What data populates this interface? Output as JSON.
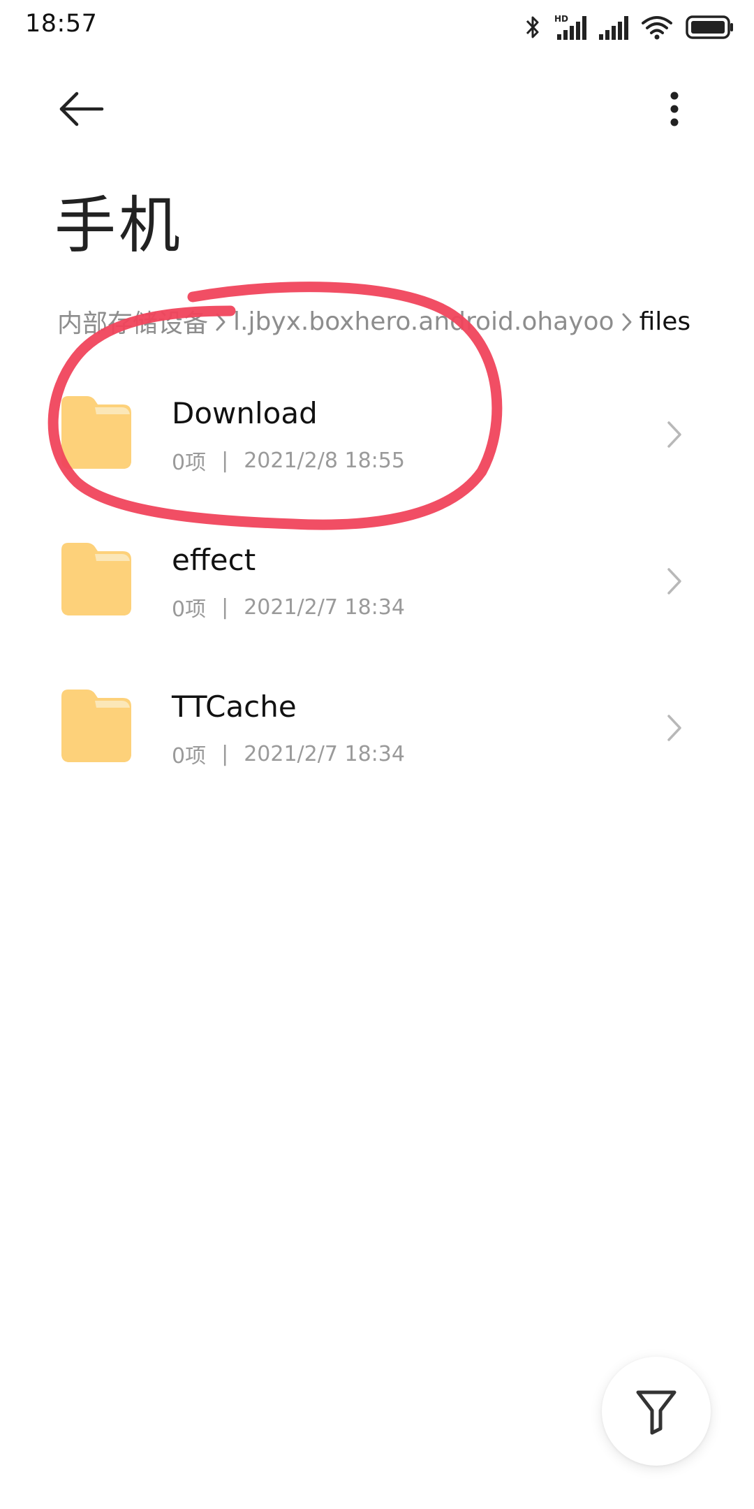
{
  "status_bar": {
    "time": "18:57",
    "icons": [
      "bluetooth-icon",
      "hd-signal-icon",
      "signal-icon",
      "wifi-icon",
      "battery-icon"
    ],
    "hd_label": "HD"
  },
  "toolbar": {
    "back_icon": "arrow-left-icon",
    "more_icon": "more-vertical-icon"
  },
  "page": {
    "title": "手机"
  },
  "breadcrumb": {
    "items": [
      {
        "label": "内部存储设备"
      },
      {
        "label": "l.jbyx.boxhero.android.ohayoo"
      },
      {
        "label": "files"
      }
    ]
  },
  "files": [
    {
      "name": "Download",
      "count": "0项",
      "date": "2021/2/8 18:55"
    },
    {
      "name": "effect",
      "count": "0项",
      "date": "2021/2/7 18:34"
    },
    {
      "name": "TTCache",
      "count": "0项",
      "date": "2021/2/7 18:34"
    }
  ],
  "meta_divider": "|",
  "fab": {
    "icon": "filter-icon"
  },
  "colors": {
    "folder": "#FDD17A",
    "folder_tab": "#FBE7B8",
    "annotation": "#F0455C",
    "muted_text": "#9a9a9a"
  }
}
